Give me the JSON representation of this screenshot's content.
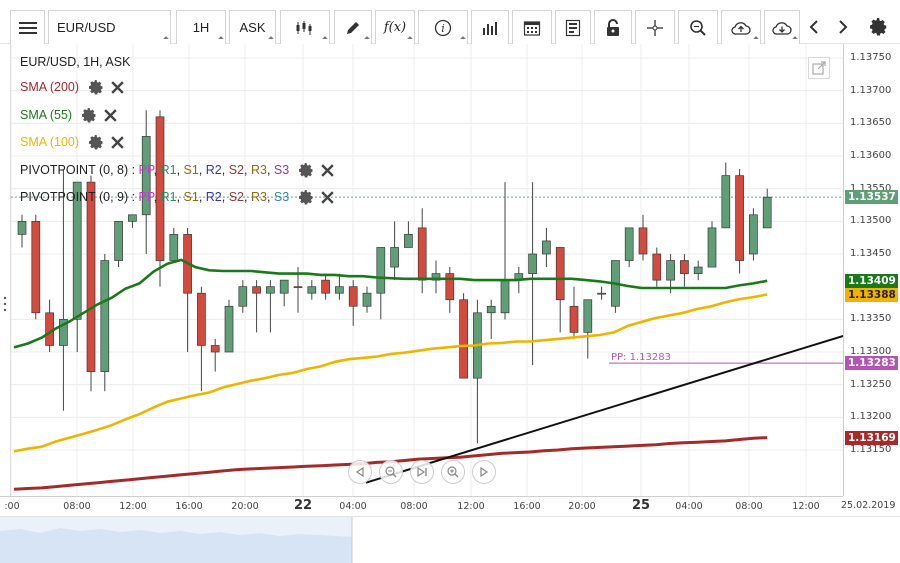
{
  "toolbar": {
    "symbol": "EUR/USD",
    "interval": "1H",
    "price_type": "ASK",
    "fx_label": "f(x)"
  },
  "legend": {
    "instrument": "EUR/USD, 1H, ASK",
    "sma200": "SMA (200)",
    "sma55": "SMA (55)",
    "sma100": "SMA (100)",
    "pivot1_name": "PIVOTPOINT (0, 8)",
    "pivot2_name": "PIVOTPOINT (0, 9)",
    "pivot_levels": [
      "PP",
      "R1",
      "S1",
      "R2",
      "S2",
      "R3",
      "S3"
    ],
    "pivot_colors": [
      "#cc33cc",
      "#2e8b57",
      "#8b6914",
      "#3333cc",
      "#8b3a3a",
      "#8b6914",
      "#993399"
    ],
    "pivot2_colors": [
      "#cc33cc",
      "#2e8b57",
      "#8b6914",
      "#3333cc",
      "#8b3a3a",
      "#8b6914",
      "#2e8b9e"
    ],
    "sma_colors": {
      "sma200": "#a52a2a",
      "sma55": "#1a7a1a",
      "sma100": "#f0b400"
    }
  },
  "price_axis": {
    "ticks": [
      "1.13750",
      "1.13700",
      "1.13650",
      "1.13600",
      "1.13550",
      "1.13500",
      "1.13450",
      "1.13350",
      "1.13300",
      "1.13250",
      "1.13200",
      "1.13150"
    ],
    "last_price": "1.13537",
    "sma55_value": "1.13409",
    "sma100_value": "1.13388",
    "pp_value": "1.13283",
    "sma200_value": "1.13169",
    "pp_line_label": "PP: 1.13283"
  },
  "time_axis": {
    "ticks": [
      {
        "label": ":00",
        "bold": false
      },
      {
        "label": "08:00",
        "bold": false
      },
      {
        "label": "12:00",
        "bold": false
      },
      {
        "label": "16:00",
        "bold": false
      },
      {
        "label": "20:00",
        "bold": false
      },
      {
        "label": "22",
        "bold": true
      },
      {
        "label": "04:00",
        "bold": false
      },
      {
        "label": "08:00",
        "bold": false
      },
      {
        "label": "12:00",
        "bold": false
      },
      {
        "label": "16:00",
        "bold": false
      },
      {
        "label": "20:00",
        "bold": false
      },
      {
        "label": "25",
        "bold": true
      },
      {
        "label": "04:00",
        "bold": false
      },
      {
        "label": "08:00",
        "bold": false
      },
      {
        "label": "12:00",
        "bold": false
      }
    ],
    "date": "25.02.2019"
  },
  "chart_data": {
    "type": "candlestick",
    "instrument": "EUR/USD",
    "timeframe": "1H",
    "ylim": [
      1.1313,
      1.1378
    ],
    "candles": [
      {
        "o": 1.1348,
        "h": 1.1351,
        "l": 1.1346,
        "c": 1.135
      },
      {
        "o": 1.135,
        "h": 1.1351,
        "l": 1.1335,
        "c": 1.1336
      },
      {
        "o": 1.1336,
        "h": 1.1338,
        "l": 1.133,
        "c": 1.1331
      },
      {
        "o": 1.1331,
        "h": 1.1358,
        "l": 1.1321,
        "c": 1.1335
      },
      {
        "o": 1.1335,
        "h": 1.1356,
        "l": 1.133,
        "c": 1.1356
      },
      {
        "o": 1.1356,
        "h": 1.1357,
        "l": 1.1324,
        "c": 1.1327
      },
      {
        "o": 1.1327,
        "h": 1.1345,
        "l": 1.1324,
        "c": 1.1344
      },
      {
        "o": 1.1344,
        "h": 1.135,
        "l": 1.1343,
        "c": 1.135
      },
      {
        "o": 1.135,
        "h": 1.1351,
        "l": 1.1349,
        "c": 1.1351
      },
      {
        "o": 1.1351,
        "h": 1.1367,
        "l": 1.1345,
        "c": 1.1363
      },
      {
        "o": 1.1366,
        "h": 1.1367,
        "l": 1.134,
        "c": 1.1344
      },
      {
        "o": 1.1344,
        "h": 1.1349,
        "l": 1.1344,
        "c": 1.1348
      },
      {
        "o": 1.1348,
        "h": 1.1349,
        "l": 1.133,
        "c": 1.1339
      },
      {
        "o": 1.1339,
        "h": 1.134,
        "l": 1.1324,
        "c": 1.1331
      },
      {
        "o": 1.1331,
        "h": 1.1332,
        "l": 1.1327,
        "c": 1.133
      },
      {
        "o": 1.133,
        "h": 1.1338,
        "l": 1.133,
        "c": 1.1337
      },
      {
        "o": 1.1337,
        "h": 1.1341,
        "l": 1.1336,
        "c": 1.134
      },
      {
        "o": 1.134,
        "h": 1.1341,
        "l": 1.1333,
        "c": 1.1339
      },
      {
        "o": 1.1339,
        "h": 1.1341,
        "l": 1.1333,
        "c": 1.134
      },
      {
        "o": 1.1339,
        "h": 1.1341,
        "l": 1.1337,
        "c": 1.1341
      },
      {
        "o": 1.134,
        "h": 1.1343,
        "l": 1.1336,
        "c": 1.134
      },
      {
        "o": 1.1339,
        "h": 1.1341,
        "l": 1.1338,
        "c": 1.134
      },
      {
        "o": 1.1341,
        "h": 1.1342,
        "l": 1.1338,
        "c": 1.1339
      },
      {
        "o": 1.1339,
        "h": 1.1342,
        "l": 1.1338,
        "c": 1.134
      },
      {
        "o": 1.134,
        "h": 1.1341,
        "l": 1.1334,
        "c": 1.1337
      },
      {
        "o": 1.1337,
        "h": 1.134,
        "l": 1.1336,
        "c": 1.1339
      },
      {
        "o": 1.1339,
        "h": 1.1346,
        "l": 1.1335,
        "c": 1.1346
      },
      {
        "o": 1.1343,
        "h": 1.135,
        "l": 1.1341,
        "c": 1.1346
      },
      {
        "o": 1.1346,
        "h": 1.135,
        "l": 1.1346,
        "c": 1.1348
      },
      {
        "o": 1.1349,
        "h": 1.1352,
        "l": 1.1339,
        "c": 1.1341
      },
      {
        "o": 1.1341,
        "h": 1.1344,
        "l": 1.1339,
        "c": 1.1342
      },
      {
        "o": 1.1342,
        "h": 1.1343,
        "l": 1.1336,
        "c": 1.1338
      },
      {
        "o": 1.1338,
        "h": 1.1339,
        "l": 1.1326,
        "c": 1.1326
      },
      {
        "o": 1.1326,
        "h": 1.1338,
        "l": 1.1316,
        "c": 1.1336
      },
      {
        "o": 1.1336,
        "h": 1.1338,
        "l": 1.1332,
        "c": 1.1337
      },
      {
        "o": 1.1336,
        "h": 1.1356,
        "l": 1.1335,
        "c": 1.1341
      },
      {
        "o": 1.1341,
        "h": 1.1343,
        "l": 1.1339,
        "c": 1.1342
      },
      {
        "o": 1.1342,
        "h": 1.1356,
        "l": 1.1328,
        "c": 1.1345
      },
      {
        "o": 1.1345,
        "h": 1.1349,
        "l": 1.1343,
        "c": 1.1347
      },
      {
        "o": 1.1346,
        "h": 1.1346,
        "l": 1.1333,
        "c": 1.1338
      },
      {
        "o": 1.1337,
        "h": 1.134,
        "l": 1.1332,
        "c": 1.1333
      },
      {
        "o": 1.1333,
        "h": 1.1338,
        "l": 1.1329,
        "c": 1.1338
      },
      {
        "o": 1.1339,
        "h": 1.134,
        "l": 1.1338,
        "c": 1.1339
      },
      {
        "o": 1.1337,
        "h": 1.1344,
        "l": 1.1336,
        "c": 1.1344
      },
      {
        "o": 1.1344,
        "h": 1.1349,
        "l": 1.1343,
        "c": 1.1349
      },
      {
        "o": 1.1349,
        "h": 1.1351,
        "l": 1.1344,
        "c": 1.1345
      },
      {
        "o": 1.1345,
        "h": 1.1346,
        "l": 1.134,
        "c": 1.1341
      },
      {
        "o": 1.1341,
        "h": 1.1345,
        "l": 1.1339,
        "c": 1.1344
      },
      {
        "o": 1.1344,
        "h": 1.1345,
        "l": 1.134,
        "c": 1.1342
      },
      {
        "o": 1.1342,
        "h": 1.1344,
        "l": 1.1341,
        "c": 1.1343
      },
      {
        "o": 1.1343,
        "h": 1.135,
        "l": 1.1343,
        "c": 1.1349
      },
      {
        "o": 1.1349,
        "h": 1.1359,
        "l": 1.1349,
        "c": 1.1357
      },
      {
        "o": 1.1357,
        "h": 1.1358,
        "l": 1.1342,
        "c": 1.1344
      },
      {
        "o": 1.1345,
        "h": 1.1352,
        "l": 1.1344,
        "c": 1.1351
      },
      {
        "o": 1.1349,
        "h": 1.1355,
        "l": 1.1349,
        "c": 1.13537
      }
    ],
    "sma55": [
      1.13307,
      1.13313,
      1.13322,
      1.13336,
      1.13347,
      1.1336,
      1.13373,
      1.13383,
      1.13397,
      1.13405,
      1.13423,
      1.13435,
      1.13441,
      1.1343,
      1.13425,
      1.13424,
      1.13424,
      1.13424,
      1.13422,
      1.1342,
      1.1342,
      1.1342,
      1.13418,
      1.13418,
      1.13416,
      1.13416,
      1.13414,
      1.13413,
      1.13412,
      1.13412,
      1.13412,
      1.13412,
      1.13412,
      1.1341,
      1.1341,
      1.1341,
      1.1341,
      1.13412,
      1.13412,
      1.13412,
      1.13412,
      1.1341,
      1.13408,
      1.13405,
      1.13401,
      1.13398,
      1.13398,
      1.13398,
      1.13398,
      1.13398,
      1.13398,
      1.13398,
      1.13402,
      1.13405,
      1.13409
    ],
    "sma100": [
      1.13148,
      1.13152,
      1.13155,
      1.13163,
      1.13169,
      1.13175,
      1.13181,
      1.13188,
      1.13197,
      1.13205,
      1.13215,
      1.13224,
      1.13229,
      1.13234,
      1.13238,
      1.13246,
      1.13251,
      1.13256,
      1.1326,
      1.13265,
      1.13268,
      1.13274,
      1.13278,
      1.13285,
      1.13289,
      1.13291,
      1.13293,
      1.13297,
      1.13299,
      1.13302,
      1.13305,
      1.13307,
      1.13309,
      1.1331,
      1.13313,
      1.13314,
      1.13316,
      1.13316,
      1.13318,
      1.1332,
      1.13322,
      1.13324,
      1.13326,
      1.1333,
      1.1334,
      1.13346,
      1.13352,
      1.13356,
      1.1336,
      1.13366,
      1.1337,
      1.13376,
      1.13381,
      1.13384,
      1.13388
    ],
    "sma200": [
      1.1309,
      1.13091,
      1.13092,
      1.13094,
      1.13096,
      1.13098,
      1.131,
      1.13102,
      1.13104,
      1.13106,
      1.13108,
      1.1311,
      1.13112,
      1.13114,
      1.13116,
      1.13118,
      1.1312,
      1.13121,
      1.13122,
      1.13123,
      1.13124,
      1.13125,
      1.13126,
      1.13127,
      1.13128,
      1.13129,
      1.13131,
      1.13132,
      1.13134,
      1.13136,
      1.13137,
      1.13138,
      1.13139,
      1.13141,
      1.13143,
      1.13145,
      1.13146,
      1.13147,
      1.13149,
      1.1315,
      1.13152,
      1.13153,
      1.13154,
      1.13155,
      1.13156,
      1.13157,
      1.13158,
      1.1316,
      1.13161,
      1.13162,
      1.13163,
      1.13164,
      1.13166,
      1.13168,
      1.13169
    ],
    "pivot_pp": 1.13283,
    "trendline": {
      "from": [
        1.131,
        23
      ],
      "to": [
        1.13325,
        60
      ]
    },
    "up_color": "#5f9e76",
    "down_color": "#d24b3e"
  }
}
